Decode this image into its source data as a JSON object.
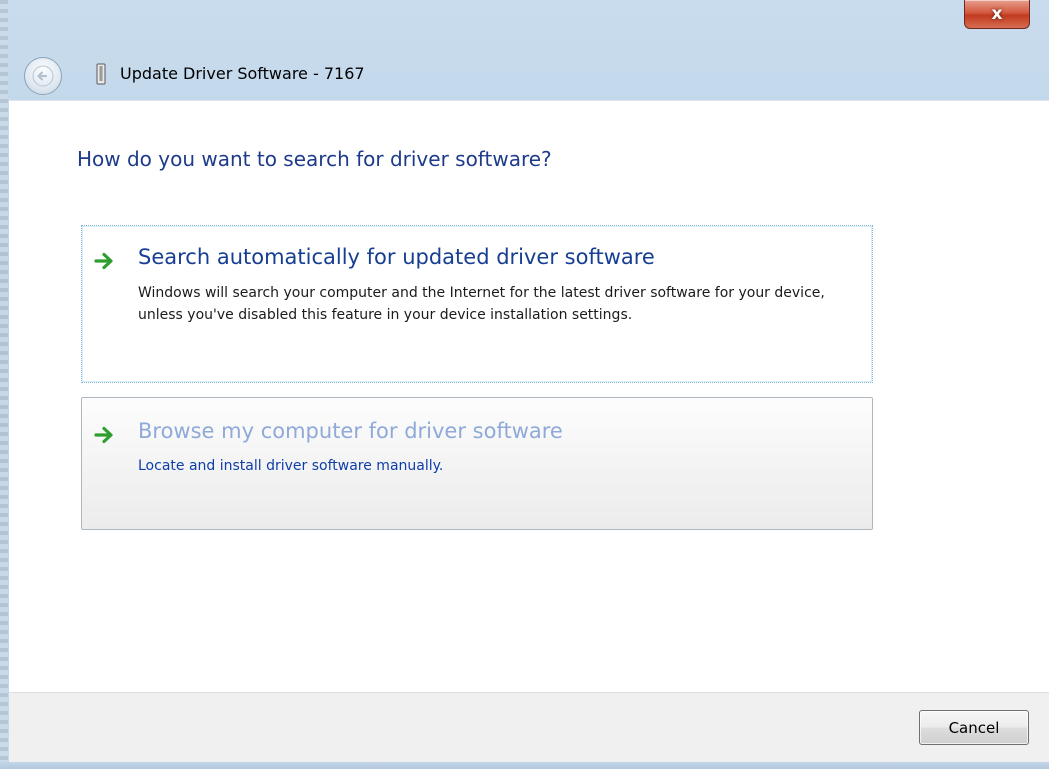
{
  "window": {
    "title": "Update Driver Software - 7167",
    "close_label": "x"
  },
  "content": {
    "heading": "How do you want to search for driver software?",
    "options": [
      {
        "title": "Search automatically for updated driver software",
        "description": "Windows will search your computer and the Internet for the latest driver software for your device, unless you've disabled this feature in your device installation settings.",
        "icon": "green-arrow-icon"
      },
      {
        "title": "Browse my computer for driver software",
        "description": "Locate and install driver software manually.",
        "icon": "green-arrow-icon"
      }
    ]
  },
  "footer": {
    "cancel_label": "Cancel"
  },
  "colors": {
    "heading": "#1e3b8a",
    "link_hover": "#8fa9d8",
    "arrow": "#2e9e2e",
    "close_button": "#c13b20"
  }
}
